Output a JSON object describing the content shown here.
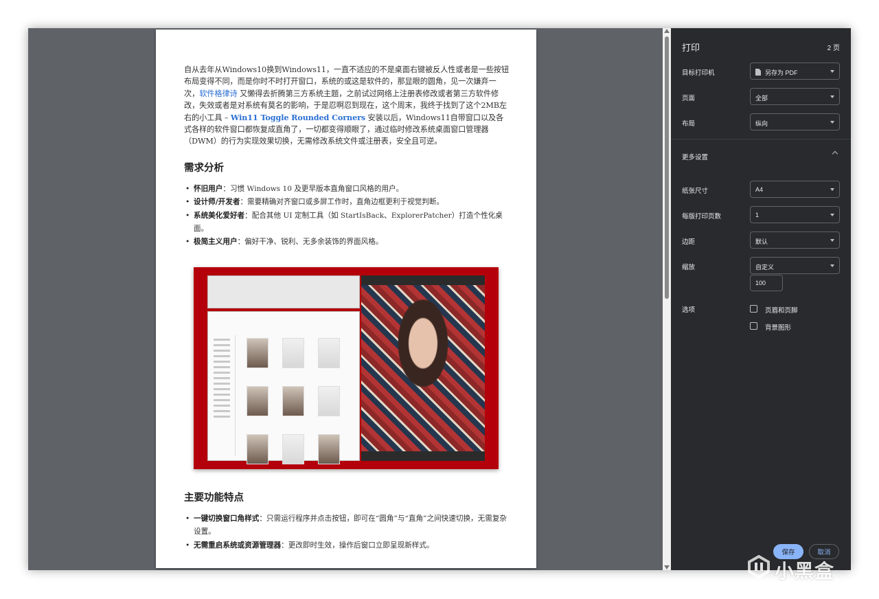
{
  "document": {
    "intro": {
      "part1": "自从去年从Windows10换到Windows11，一直不适应的不是桌面右键被反人性或者是一些按钮布局变得不同，而是你时不时打开窗口，系统的或这是软件的，那显眼的圆角，见一次嫌弃一次，",
      "link1": "软件格律诗",
      "part2": " 又懒得去折腾第三方系统主题，之前试过网络上注册表修改或者第三方软件修改，失效或者是对系统有莫名的影响，于是忍啊忍到现在，这个周末，我终于找到了这个2MB左右的小工具 – ",
      "link2": "Win11 Toggle Rounded Corners",
      "part3": " 安装以后，Windows11自带窗口以及各式各样的软件窗口都恢复成直角了，一切都变得顺眼了，通过临时修改系统桌面窗口管理器（DWM）的行为实现效果切换，无需修改系统文件或注册表，安全且可逆。"
    },
    "section1": {
      "heading": "需求分析",
      "items": [
        {
          "term": "怀旧用户",
          "desc": "：习惯 Windows 10 及更早版本直角窗口风格的用户。"
        },
        {
          "term": "设计师/开发者",
          "desc": "：需要精确对齐窗口或多屏工作时，直角边框更利于视觉判断。"
        },
        {
          "term": "系统美化爱好者",
          "desc": "：配合其他 UI 定制工具（如 StartIsBack、ExplorerPatcher）打造个性化桌面。"
        },
        {
          "term": "极简主义用户",
          "desc": "：偏好干净、锐利、无多余装饰的界面风格。"
        }
      ]
    },
    "section2": {
      "heading": "主要功能特点",
      "items": [
        {
          "term": "一键切换窗口角样式",
          "desc": "：只需运行程序并点击按钮，即可在“圆角”与“直角”之间快速切换，无需复杂设置。"
        },
        {
          "term": "无需重启系统或资源管理器",
          "desc": "：更改即时生效，操作后窗口立即呈现新样式。"
        }
      ]
    }
  },
  "print_panel": {
    "title": "打印",
    "page_count": "2 页",
    "destination": {
      "label": "目标打印机",
      "value": "另存为 PDF",
      "icon": "document-icon"
    },
    "pages": {
      "label": "页面",
      "value": "全部"
    },
    "layout": {
      "label": "布局",
      "value": "纵向"
    },
    "more_settings": {
      "label": "更多设置",
      "icon": "chevron-up-icon"
    },
    "paper_size": {
      "label": "纸张尺寸",
      "value": "A4"
    },
    "pages_per_sheet": {
      "label": "每版打印页数",
      "value": "1"
    },
    "margins": {
      "label": "边距",
      "value": "默认"
    },
    "scale": {
      "label": "缩放",
      "value": "自定义",
      "custom_value": "100"
    },
    "options": {
      "label": "选项",
      "headers_footers": {
        "label": "页眉和页脚",
        "checked": false
      },
      "background_graphics": {
        "label": "背景图形",
        "checked": false
      }
    },
    "save_label": "保存",
    "cancel_label": "取消"
  },
  "colors": {
    "panel_bg": "#292a2d",
    "preview_bg": "#5f6368",
    "accent": "#8ab4f8",
    "link": "#2a6fd3"
  },
  "watermark": {
    "text": "小黑盒",
    "icon": "heybox-logo-icon"
  }
}
